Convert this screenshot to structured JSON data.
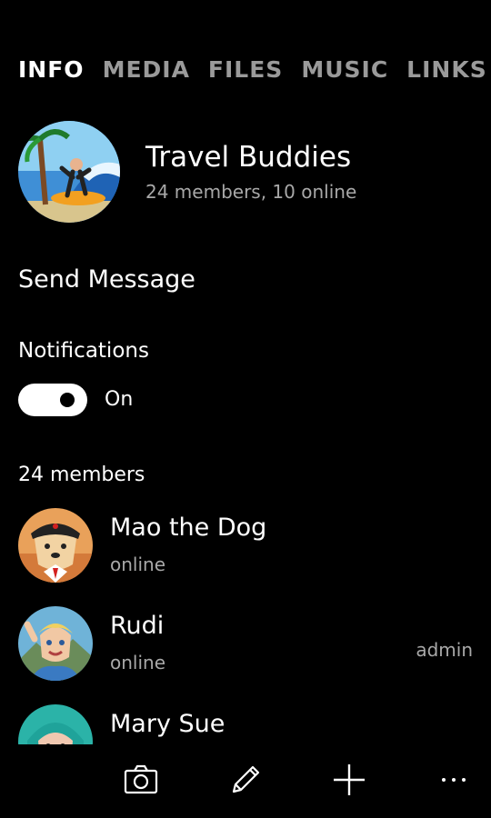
{
  "tabs": [
    {
      "label": "INFO",
      "active": true
    },
    {
      "label": "MEDIA",
      "active": false
    },
    {
      "label": "FILES",
      "active": false
    },
    {
      "label": "MUSIC",
      "active": false
    },
    {
      "label": "LINKS",
      "active": false
    }
  ],
  "group": {
    "title": "Travel Buddies",
    "subtitle": "24 members, 10 online"
  },
  "actions": {
    "send_message": "Send Message"
  },
  "notifications": {
    "label": "Notifications",
    "state": "On",
    "enabled": true
  },
  "members": {
    "header": "24 members",
    "items": [
      {
        "name": "Mao the Dog",
        "status": "online",
        "role": ""
      },
      {
        "name": "Rudi",
        "status": "online",
        "role": "admin"
      },
      {
        "name": "Mary Sue",
        "status": "",
        "role": ""
      }
    ]
  },
  "appbar": {
    "icons": [
      "camera-icon",
      "pencil-icon",
      "add-icon",
      "more-icon"
    ]
  }
}
